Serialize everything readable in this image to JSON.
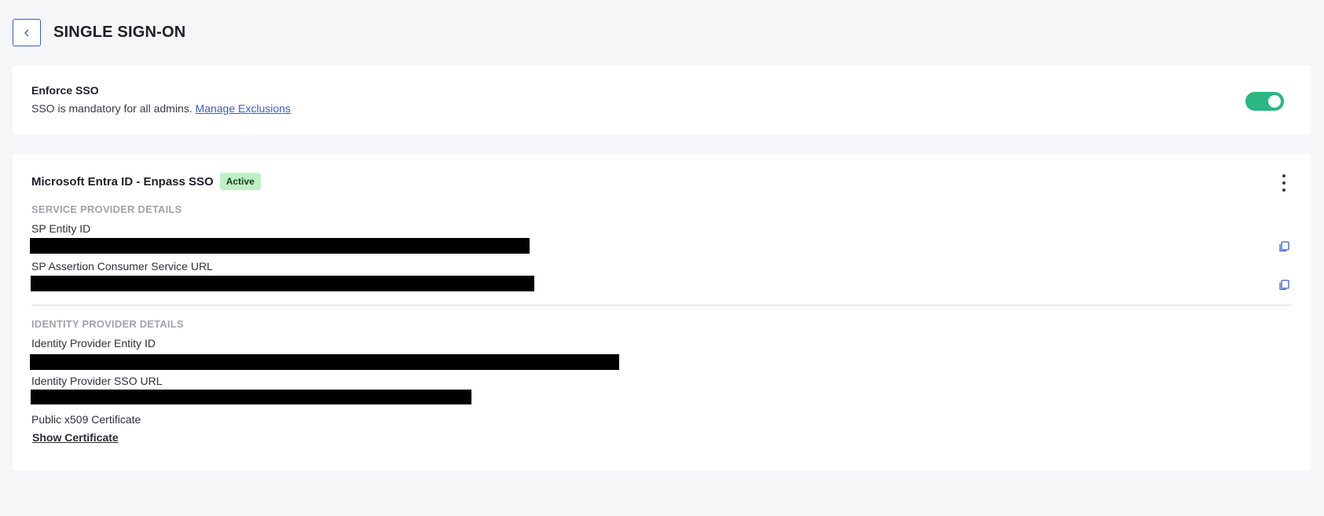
{
  "header": {
    "back_icon": "chevron-left-icon",
    "title": "SINGLE SIGN-ON"
  },
  "enforce": {
    "title": "Enforce SSO",
    "description": "SSO is mandatory for all admins.",
    "link_label": "Manage Exclusions",
    "toggle_on": true,
    "toggle_color": "#2cb682"
  },
  "sso_config": {
    "name": "Microsoft Entra ID - Enpass SSO",
    "status": "Active",
    "menu_icon": "more-vertical-icon",
    "service_provider": {
      "heading": "SERVICE PROVIDER DETAILS",
      "entity_id_label": "SP Entity ID",
      "acs_url_label": "SP Assertion Consumer Service URL",
      "copy_icon": "copy-icon"
    },
    "identity_provider": {
      "heading": "IDENTITY PROVIDER DETAILS",
      "entity_id_label": "Identity Provider Entity ID",
      "sso_url_label": "Identity Provider SSO URL",
      "cert_label": "Public x509 Certificate",
      "show_cert_label": "Show Certificate"
    }
  },
  "colors": {
    "accent": "#3b5bcf",
    "active_badge_bg": "#bff0c5",
    "page_bg": "#f5f6f8"
  }
}
